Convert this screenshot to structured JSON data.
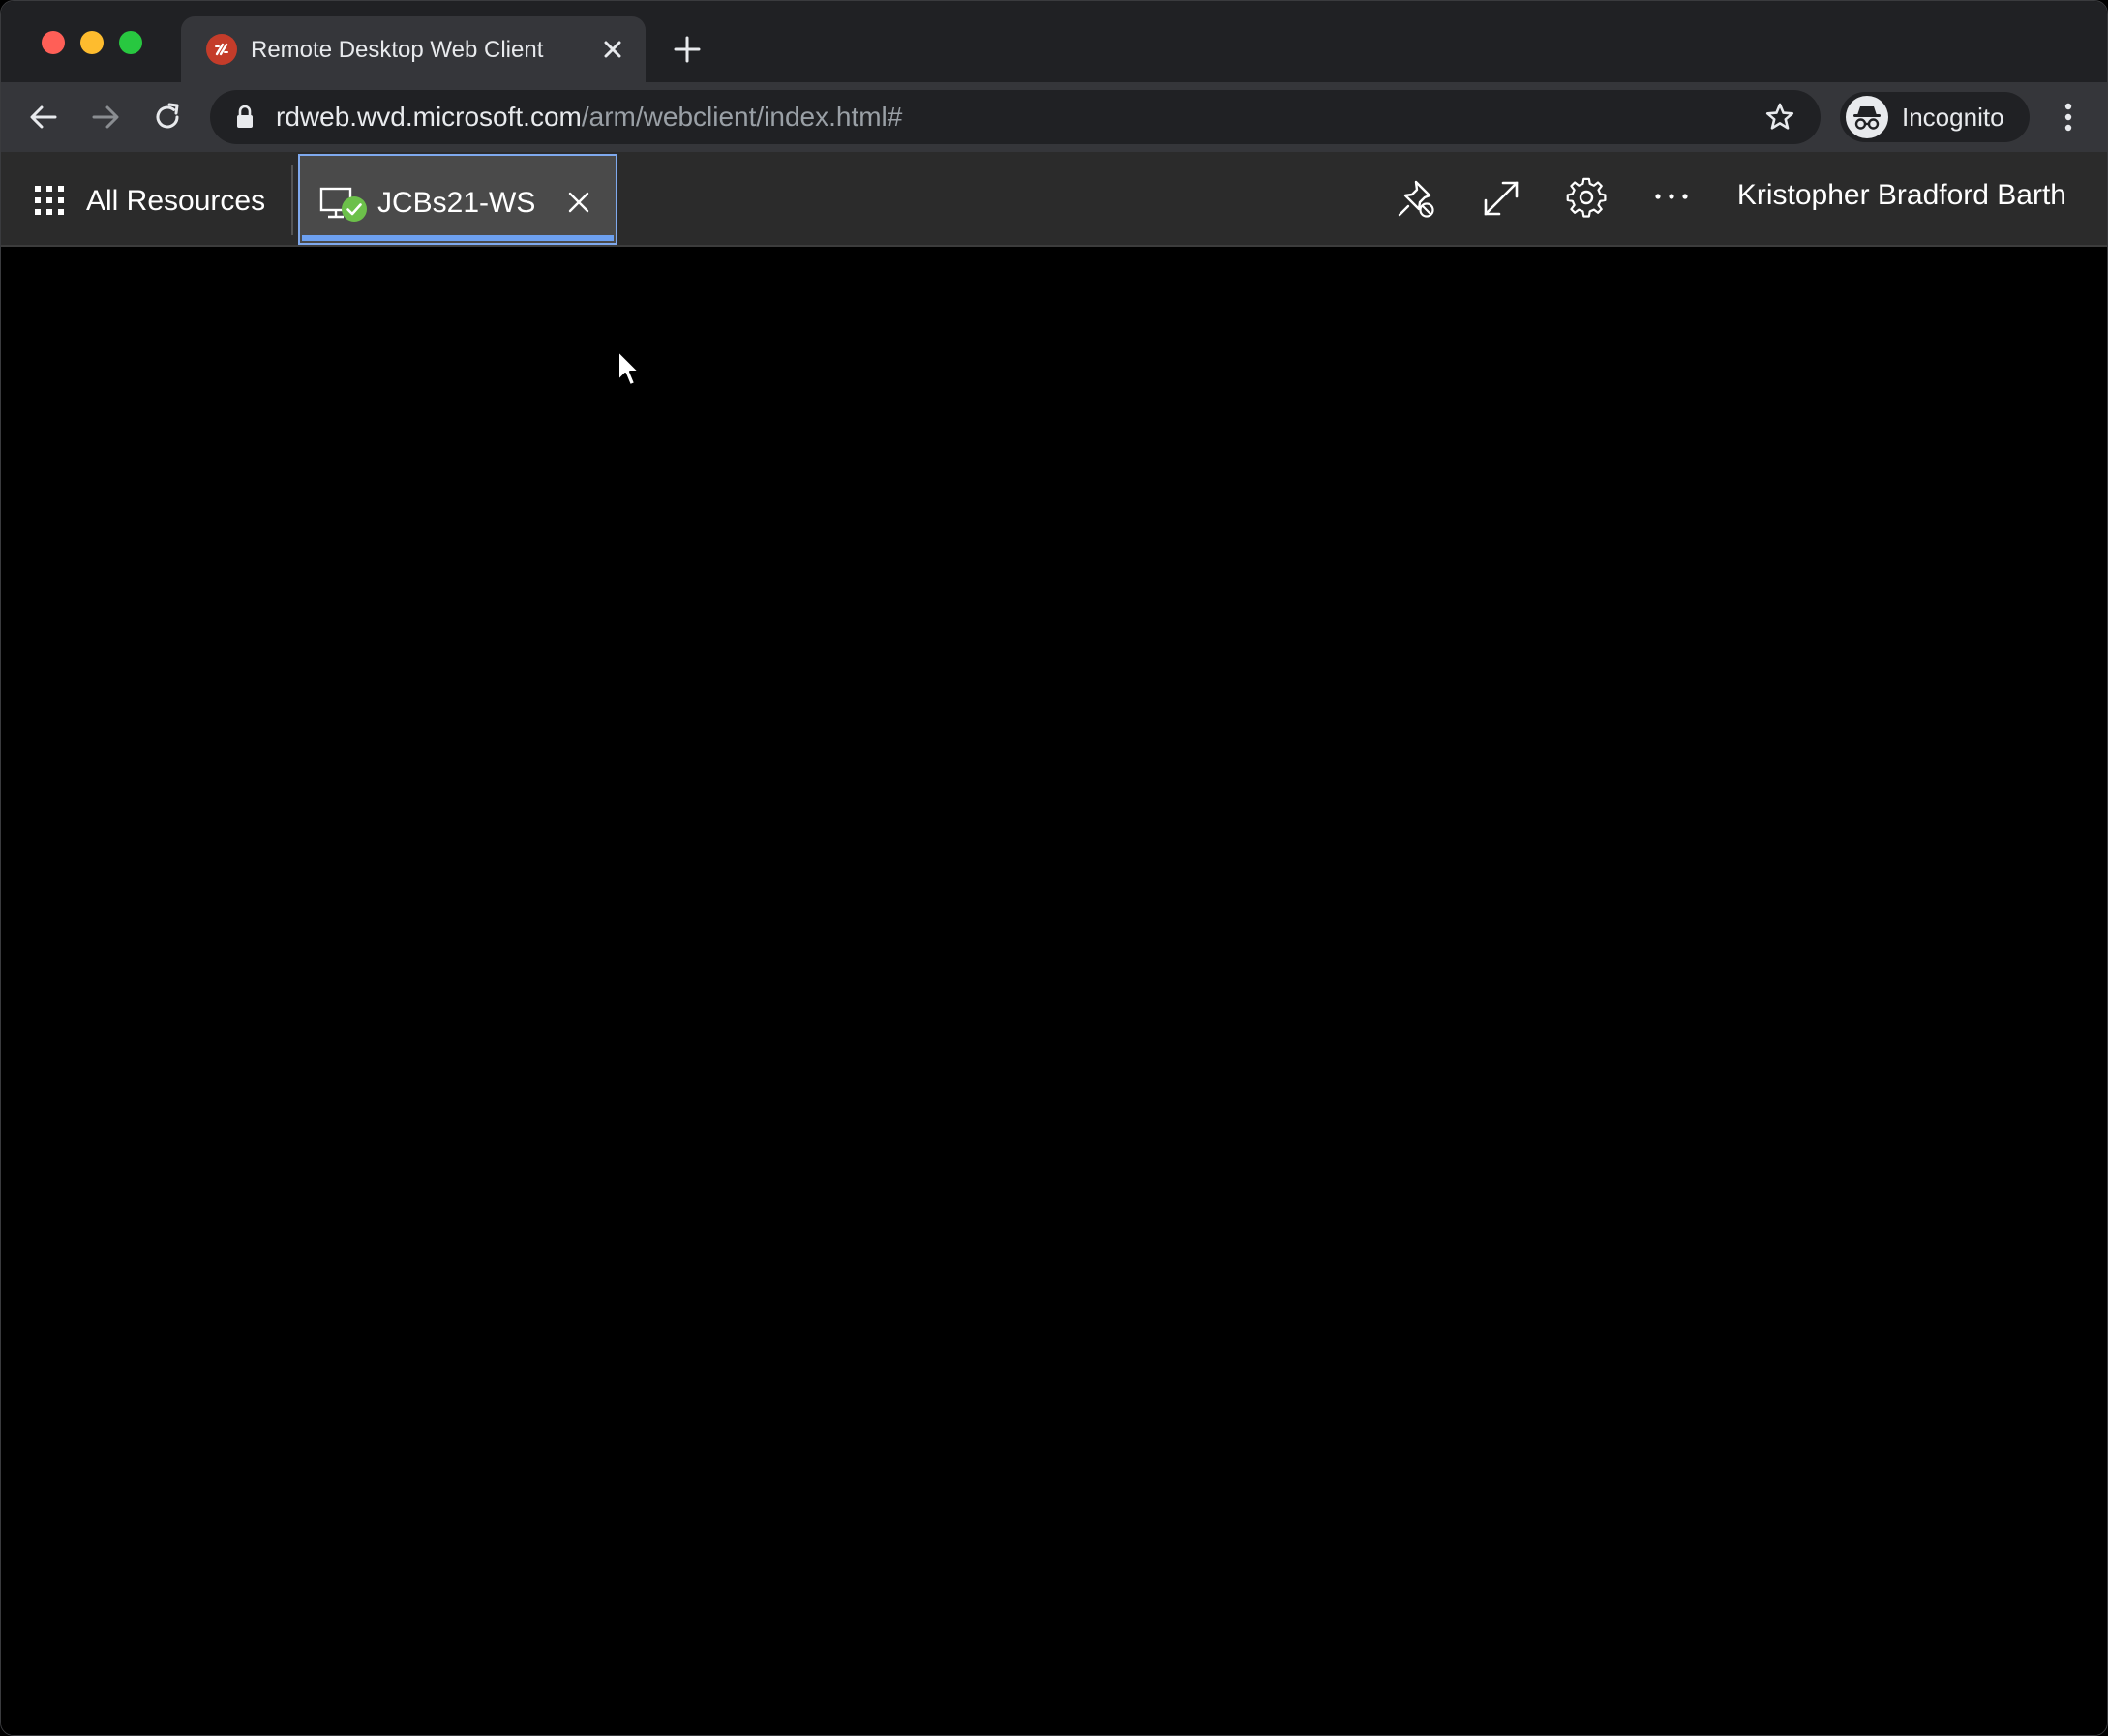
{
  "browser": {
    "tab_title": "Remote Desktop Web Client",
    "url_host": "rdweb.wvd.microsoft.com",
    "url_path": "/arm/webclient/index.html#",
    "profile_label": "Incognito"
  },
  "rd_client": {
    "all_resources_label": "All Resources",
    "session_tab_label": "JCBs21-WS",
    "user_name": "Kristopher Bradford Barth"
  },
  "colors": {
    "accent": "#6da0f0",
    "status_ok": "#6cc04a",
    "favicon": "#c43c2a"
  }
}
